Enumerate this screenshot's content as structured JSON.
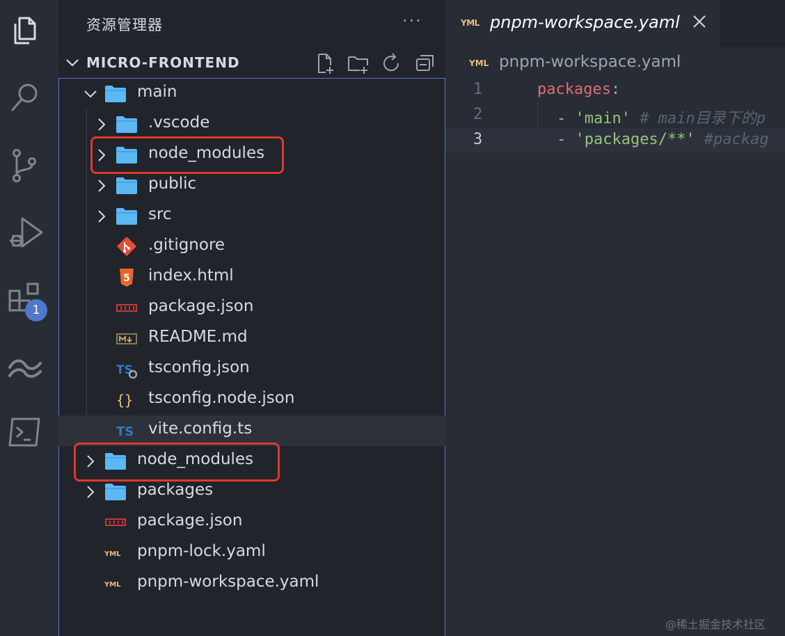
{
  "explorer": {
    "title": "资源管理器",
    "more": "···",
    "root_label": "MICRO-FRONTEND"
  },
  "tree": [
    {
      "label": "main",
      "kind": "folder",
      "state": "expanded"
    },
    {
      "label": ".vscode",
      "kind": "folder",
      "state": "collapsed"
    },
    {
      "label": "node_modules",
      "kind": "folder",
      "state": "collapsed",
      "highlighted": true
    },
    {
      "label": "public",
      "kind": "folder",
      "state": "collapsed"
    },
    {
      "label": "src",
      "kind": "folder",
      "state": "collapsed"
    },
    {
      "label": ".gitignore",
      "kind": "git",
      "state": "file"
    },
    {
      "label": "index.html",
      "kind": "html",
      "state": "file"
    },
    {
      "label": "package.json",
      "kind": "npm",
      "state": "file"
    },
    {
      "label": "README.md",
      "kind": "markdown",
      "state": "file"
    },
    {
      "label": "tsconfig.json",
      "kind": "tsconfig",
      "state": "file"
    },
    {
      "label": "tsconfig.node.json",
      "kind": "json",
      "state": "file"
    },
    {
      "label": "vite.config.ts",
      "kind": "typescript",
      "state": "file"
    },
    {
      "label": "node_modules",
      "kind": "folder",
      "state": "collapsed",
      "highlighted": true
    },
    {
      "label": "packages",
      "kind": "folder",
      "state": "collapsed"
    },
    {
      "label": "package.json",
      "kind": "npm",
      "state": "file"
    },
    {
      "label": "pnpm-lock.yaml",
      "kind": "yaml",
      "state": "file"
    },
    {
      "label": "pnpm-workspace.yaml",
      "kind": "yaml",
      "state": "file"
    }
  ],
  "activity": {
    "extensions_badge": "1"
  },
  "editor": {
    "tab_label": "pnpm-workspace.yaml",
    "tab_icon_text": "YML",
    "breadcrumb": "pnpm-workspace.yaml",
    "lines": [
      {
        "number": "1",
        "key": "packages",
        "colon": ":"
      },
      {
        "number": "2",
        "dash": "- ",
        "value": "'main'",
        "comment": " # main目录下的p"
      },
      {
        "number": "3",
        "dash": "- ",
        "value": "'packages/**'",
        "comment": " #packag"
      }
    ]
  },
  "watermark": "@稀土掘金技术社区",
  "colors": {
    "highlight": "#e0382b",
    "focus_border": "#4d78cc",
    "folder": "#5bb8f5",
    "yaml": "#e5c07b"
  }
}
